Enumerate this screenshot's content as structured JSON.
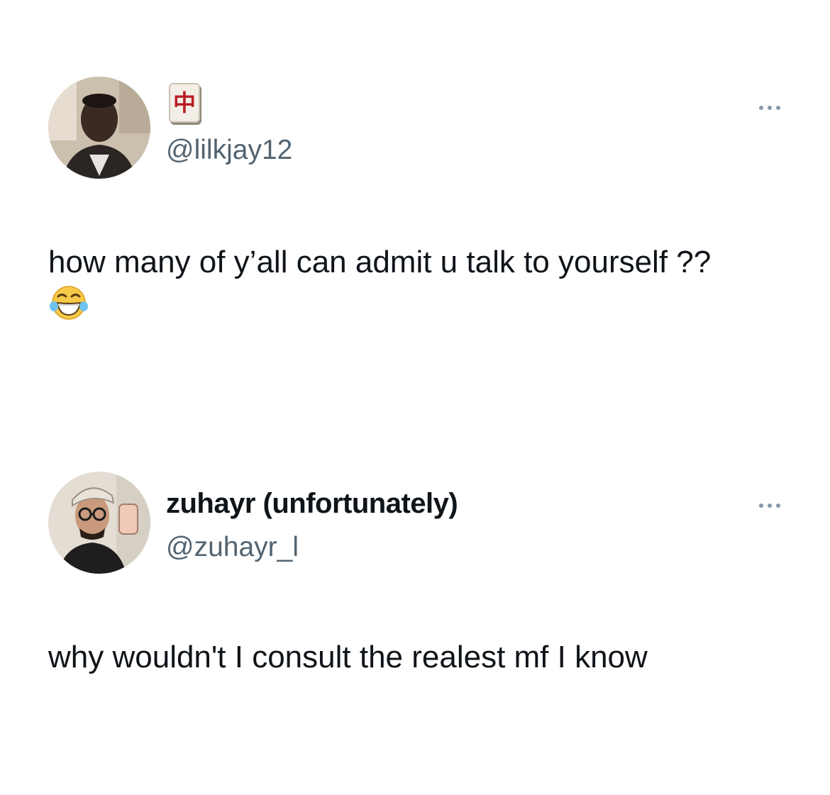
{
  "tweets": [
    {
      "avatar_icon": "profile-photo-icon",
      "badge_icon": "mahjong-red-dragon-icon",
      "badge_glyph": "中",
      "handle": "@lilkjay12",
      "text": "how many of y’all can admit u talk to yourself ??",
      "emoji_icon": "face-with-tears-of-joy-icon",
      "more_icon": "more-options-icon"
    },
    {
      "avatar_icon": "profile-photo-icon",
      "display_name": "zuhayr (unfortunately)",
      "handle": "@zuhayr_l",
      "text": "why wouldn't I consult the realest mf I know",
      "more_icon": "more-options-icon"
    }
  ],
  "colors": {
    "text": "#0f1419",
    "secondary_text": "#536471",
    "more_dots": "#8a98a5",
    "background": "#ffffff",
    "badge_glyph": "#b81c22"
  }
}
